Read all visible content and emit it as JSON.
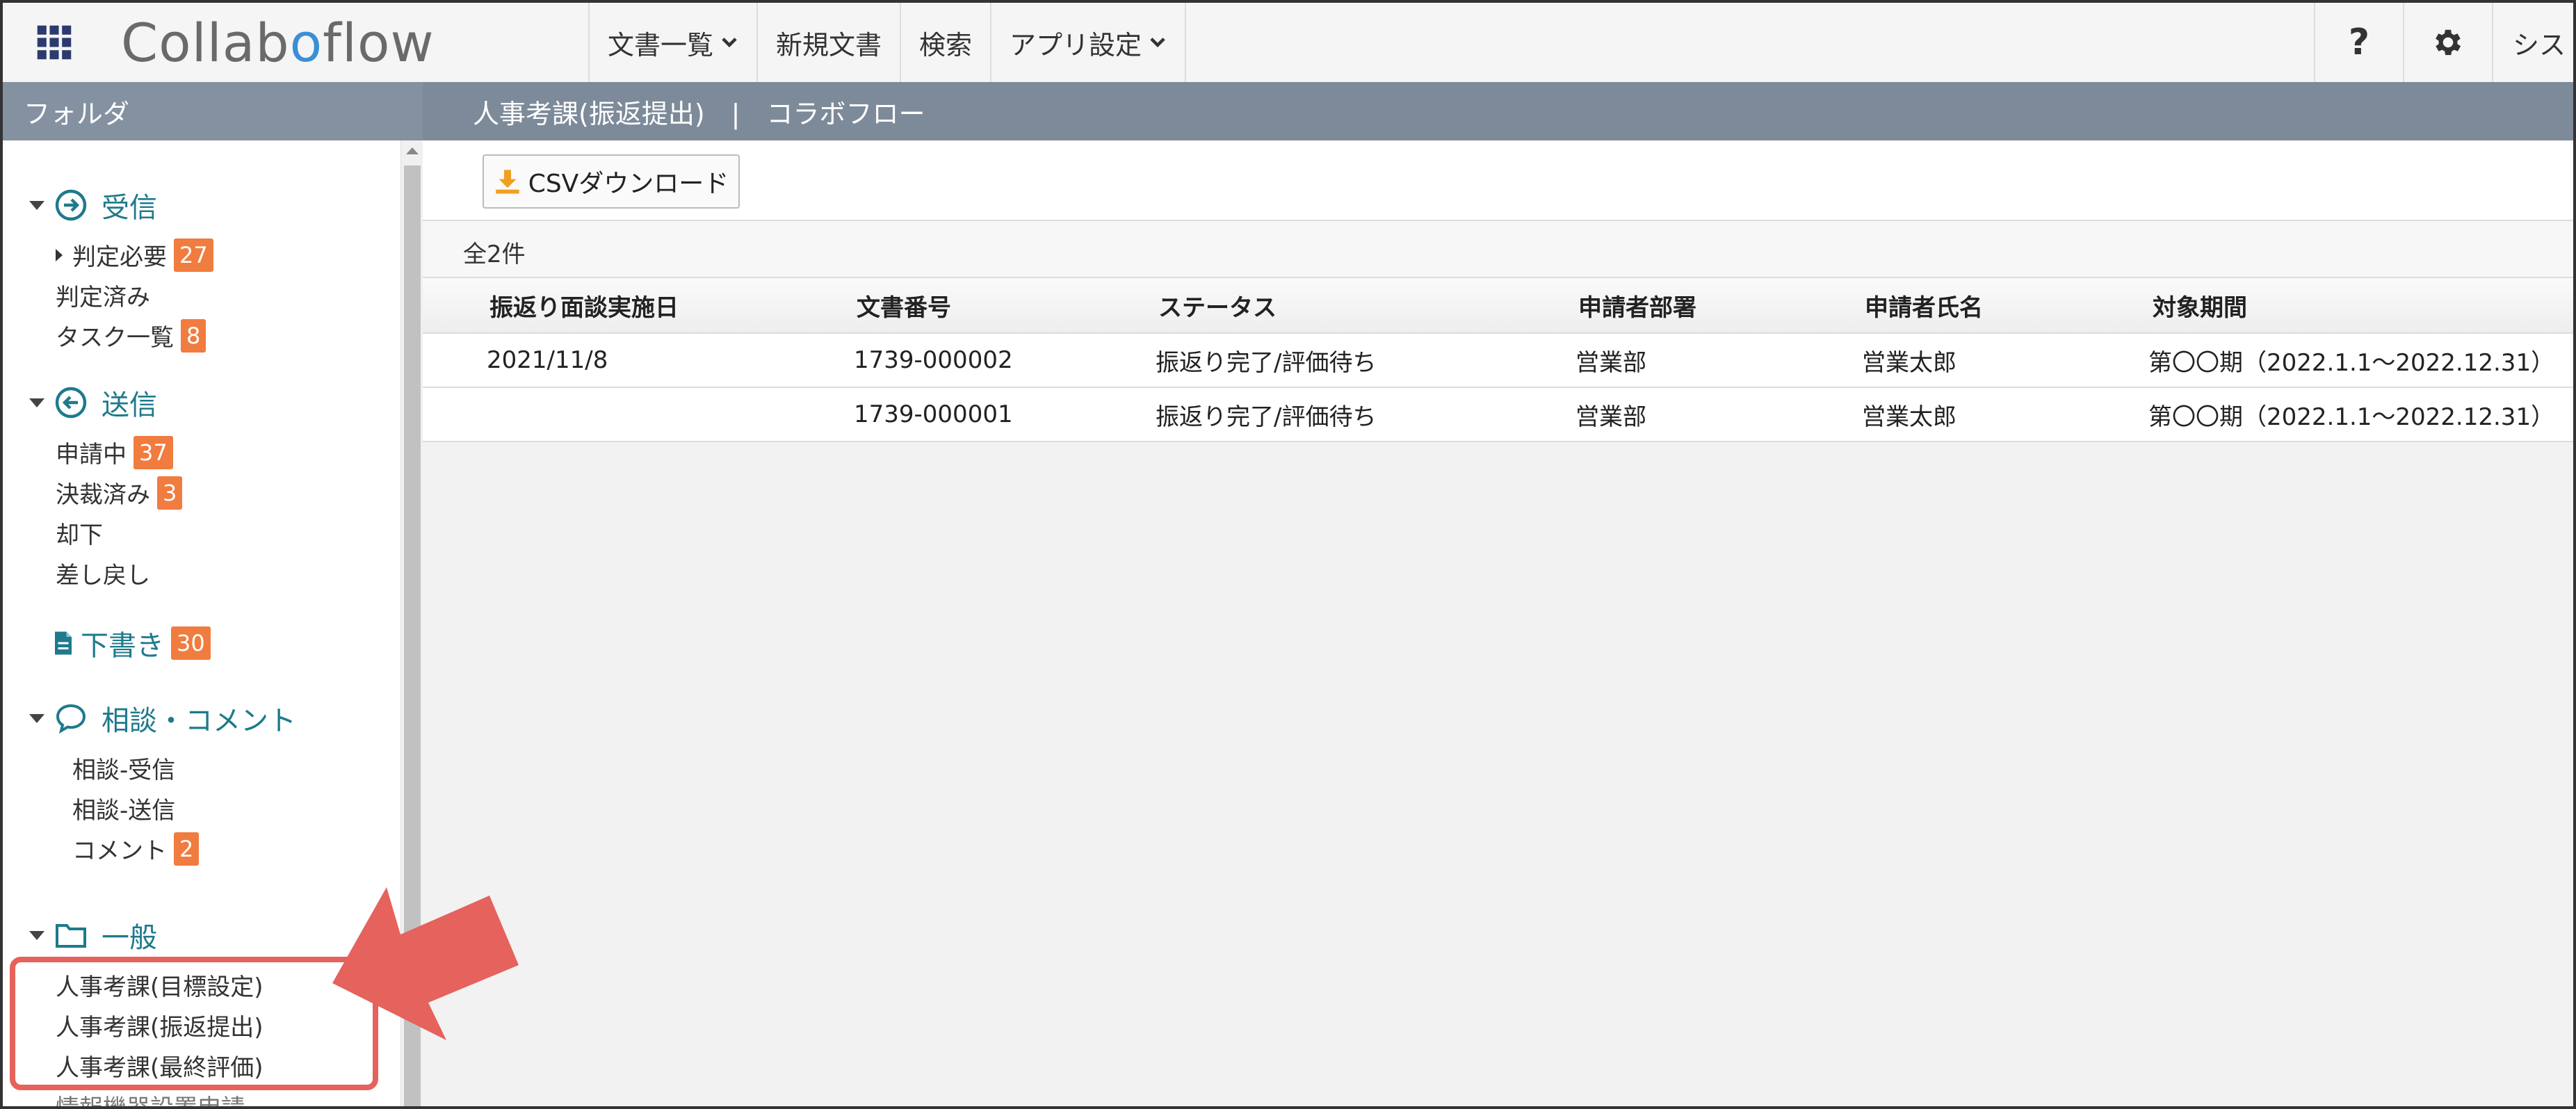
{
  "app": {
    "logo_pre": "Collab",
    "logo_accent": "o",
    "logo_post": "flow"
  },
  "nav": [
    {
      "label": "文書一覧",
      "dropdown": true
    },
    {
      "label": "新規文書",
      "dropdown": false
    },
    {
      "label": "検索",
      "dropdown": false
    },
    {
      "label": "アプリ設定",
      "dropdown": true
    }
  ],
  "tools": {
    "help": "?",
    "system_label": "シス"
  },
  "sidebar": {
    "header": "フォルダ",
    "receive": {
      "title": "受信",
      "items": [
        {
          "label": "判定必要",
          "badge": "27"
        },
        {
          "label": "判定済み",
          "badge": ""
        },
        {
          "label": "タスク一覧",
          "badge": "8"
        }
      ]
    },
    "send": {
      "title": "送信",
      "items": [
        {
          "label": "申請中",
          "badge": "37"
        },
        {
          "label": "決裁済み",
          "badge": "3"
        },
        {
          "label": "却下",
          "badge": ""
        },
        {
          "label": "差し戻し",
          "badge": ""
        }
      ]
    },
    "draft": {
      "label": "下書き",
      "badge": "30"
    },
    "consult": {
      "title": "相談・コメント",
      "items": [
        {
          "label": "相談-受信",
          "badge": ""
        },
        {
          "label": "相談-送信",
          "badge": ""
        },
        {
          "label": "コメント",
          "badge": "2"
        }
      ]
    },
    "general": {
      "title": "一般",
      "items": [
        {
          "label": "人事考課(目標設定)"
        },
        {
          "label": "人事考課(振返提出)"
        },
        {
          "label": "人事考課(最終評価)"
        },
        {
          "label": "情報機器設置申請"
        }
      ]
    }
  },
  "main": {
    "header": "人事考課(振返提出)　|　コラボフロー",
    "csv_label": "CSVダウンロード",
    "count": "全2件",
    "columns": [
      "振返り面談実施日",
      "文書番号",
      "ステータス",
      "申請者部署",
      "申請者氏名",
      "対象期間"
    ],
    "rows": [
      [
        "2021/11/8",
        "1739-000002",
        "振返り完了/評価待ち",
        "営業部",
        "営業太郎",
        "第〇〇期（2022.1.1～2022.12.31）"
      ],
      [
        "",
        "1739-000001",
        "振返り完了/評価待ち",
        "営業部",
        "営業太郎",
        "第〇〇期（2022.1.1～2022.12.31）"
      ]
    ]
  },
  "colors": {
    "accent": "#1e7a8c",
    "badge": "#f07c3f",
    "header": "#7d8a99",
    "highlight": "#e5625d"
  }
}
